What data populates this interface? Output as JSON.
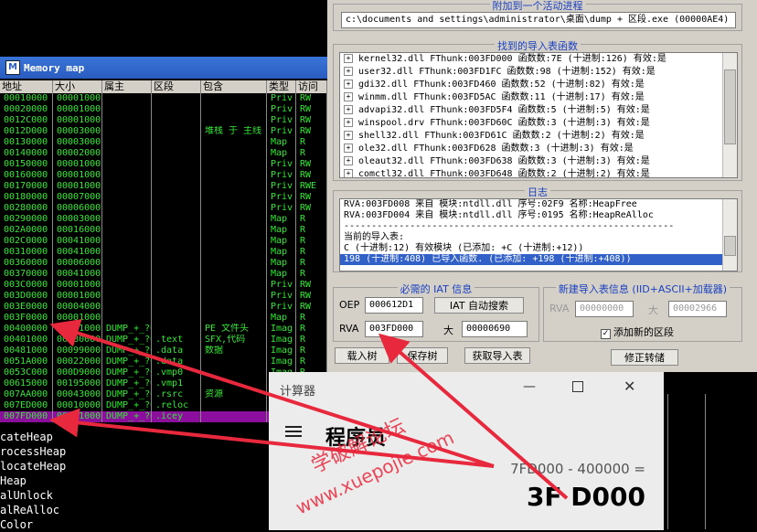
{
  "memory_map": {
    "title": "Memory map",
    "icon_letter": "M",
    "columns": [
      "地址",
      "大小",
      "属主",
      "区段",
      "包含",
      "类型",
      "访问"
    ],
    "rows": [
      [
        "00010000",
        "00001000",
        "",
        "",
        "",
        "Priv",
        "RW"
      ],
      [
        "00020000",
        "00001000",
        "",
        "",
        "",
        "Priv",
        "RW"
      ],
      [
        "0012C000",
        "00001000",
        "",
        "",
        "",
        "Priv",
        "RW"
      ],
      [
        "0012D000",
        "00003000",
        "",
        "",
        "堆栈 于 主线",
        "Priv",
        "RW"
      ],
      [
        "00130000",
        "00003000",
        "",
        "",
        "",
        "Map",
        "R"
      ],
      [
        "00140000",
        "00002000",
        "",
        "",
        "",
        "Map",
        "R"
      ],
      [
        "00150000",
        "00001000",
        "",
        "",
        "",
        "Priv",
        "RW"
      ],
      [
        "00160000",
        "00001000",
        "",
        "",
        "",
        "Priv",
        "RW"
      ],
      [
        "00170000",
        "00001000",
        "",
        "",
        "",
        "Priv",
        "RWE"
      ],
      [
        "00180000",
        "00007000",
        "",
        "",
        "",
        "Priv",
        "RW"
      ],
      [
        "00280000",
        "00006000",
        "",
        "",
        "",
        "Priv",
        "RW"
      ],
      [
        "00290000",
        "00003000",
        "",
        "",
        "",
        "Map",
        "R"
      ],
      [
        "002A0000",
        "00016000",
        "",
        "",
        "",
        "Map",
        "R"
      ],
      [
        "002C0000",
        "00041000",
        "",
        "",
        "",
        "Map",
        "R"
      ],
      [
        "00310000",
        "00041000",
        "",
        "",
        "",
        "Map",
        "R"
      ],
      [
        "00360000",
        "00006000",
        "",
        "",
        "",
        "Map",
        "R"
      ],
      [
        "00370000",
        "00041000",
        "",
        "",
        "",
        "Map",
        "R"
      ],
      [
        "003C0000",
        "00001000",
        "",
        "",
        "",
        "Priv",
        "RW"
      ],
      [
        "003D0000",
        "00001000",
        "",
        "",
        "",
        "Priv",
        "RW"
      ],
      [
        "003E0000",
        "00004000",
        "",
        "",
        "",
        "Priv",
        "RW"
      ],
      [
        "003F0000",
        "00001000",
        "",
        "",
        "",
        "Map",
        "R"
      ],
      [
        "00400000",
        "00001000",
        "DUMP_+_?0",
        "",
        "PE 文件头",
        "Imag",
        "R"
      ],
      [
        "00401000",
        "00080000",
        "DUMP_+_?0",
        ".text",
        "SFX,代码",
        "Imag",
        "R"
      ],
      [
        "00481000",
        "00099000",
        "DUMP_+_?0",
        ".data",
        "数据",
        "Imag",
        "R"
      ],
      [
        "0051A000",
        "00022000",
        "DUMP_+_?0",
        ".data",
        "",
        "Imag",
        "R"
      ],
      [
        "0053C000",
        "000D9000",
        "DUMP_+_?0",
        ".vmp0",
        "",
        "Imag",
        "R"
      ],
      [
        "00615000",
        "00195000",
        "DUMP_+_?0",
        ".vmp1",
        "",
        "Imag",
        "R"
      ],
      [
        "007AA000",
        "00043000",
        "DUMP_+_?0",
        ".rsrc",
        "资源",
        "Imag",
        "R"
      ],
      [
        "007ED000",
        "00010000",
        "DUMP_+_?0",
        ".reloc",
        "",
        "Imag",
        "R"
      ],
      [
        "007FD000",
        "00001000",
        "DUMP_+_?0",
        ".icey",
        "",
        "Imag",
        "R"
      ]
    ],
    "selected_row": 29
  },
  "console_lines": [
    "cateHeap",
    "rocessHeap",
    "locateHeap",
    "Heap",
    "alUnlock",
    "alReAlloc",
    "Color"
  ],
  "importrec": {
    "process_group_title": "附加到一个活动进程",
    "process_value": "c:\\documents and settings\\administrator\\桌面\\dump + 区段.exe (00000AE4)",
    "imports_group_title": "找到的导入表函数",
    "imports": [
      "kernel32.dll FThunk:003FD000 函数数:7E (十进制:126) 有效:是",
      "user32.dll FThunk:003FD1FC 函数数:98 (十进制:152) 有效:是",
      "gdi32.dll FThunk:003FD460 函数数:52 (十进制:82) 有效:是",
      "winmm.dll FThunk:003FD5AC 函数数:11 (十进制:17) 有效:是",
      "advapi32.dll FThunk:003FD5F4 函数数:5 (十进制:5) 有效:是",
      "winspool.drv FThunk:003FD60C 函数数:3 (十进制:3) 有效:是",
      "shell32.dll FThunk:003FD61C 函数数:2 (十进制:2) 有效:是",
      "ole32.dll FThunk:003FD628 函数数:3 (十进制:3) 有效:是",
      "oleaut32.dll FThunk:003FD638 函数数:3 (十进制:3) 有效:是",
      "comctl32.dll FThunk:003FD648 函数数:2 (十进制:2) 有效:是"
    ],
    "log_group_title": "日志",
    "log_lines": [
      "RVA:003FD008 来自 模块:ntdll.dll 序号:02F9 名称:HeapFree",
      "RVA:003FD004 来自 模块:ntdll.dll 序号:0195 名称:HeapReAlloc",
      "------------------------------------------------------------",
      "当前的导入表:",
      "C (十进制:12) 有效模块 (已添加: +C (十进制:+12))",
      "198 (十进制:408) 已导入函数. (已添加: +198 (十进制:+408))"
    ],
    "log_selected": 5,
    "iat_group_title": "必需的 IAT 信息",
    "oep_label": "OEP",
    "oep_value": "000612D1",
    "iat_search_button": "IAT 自动搜索",
    "rva_label": "RVA",
    "rva_value": "003FD000",
    "size_label": "大",
    "size_value": "00000690",
    "new_group_title": "新建导入表信息 (IID+ASCII+加载器)",
    "new_rva_label": "RVA",
    "new_rva_value": "00000000",
    "new_size_label": "大",
    "new_size_value": "00002966",
    "add_section_label": "添加新的区段",
    "load_tree_button": "载入树",
    "save_tree_button": "保存树",
    "get_imports_button": "获取导入表",
    "fix_dump_button": "修正转储"
  },
  "calculator": {
    "title": "计算器",
    "mode": "程序员",
    "expression": "7FD000 - 400000 =",
    "result": "3F D000"
  },
  "watermark": [
    "学破解论坛",
    "www.xuepojie.com"
  ],
  "colors": {
    "arrow": "#e8283c",
    "selected_row": "#8b0e9c",
    "mem_text": "#33e833",
    "group_title": "#1a40c0"
  }
}
